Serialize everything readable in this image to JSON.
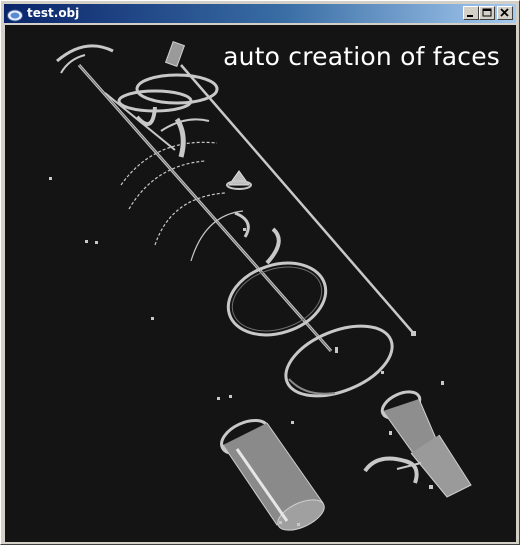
{
  "window": {
    "title": "test.obj",
    "controls": [
      "minimize",
      "maximize",
      "close"
    ]
  },
  "viewport": {
    "overlay_text": "auto creation of faces",
    "background": "#141414",
    "model_color": "#c8c8c8"
  }
}
